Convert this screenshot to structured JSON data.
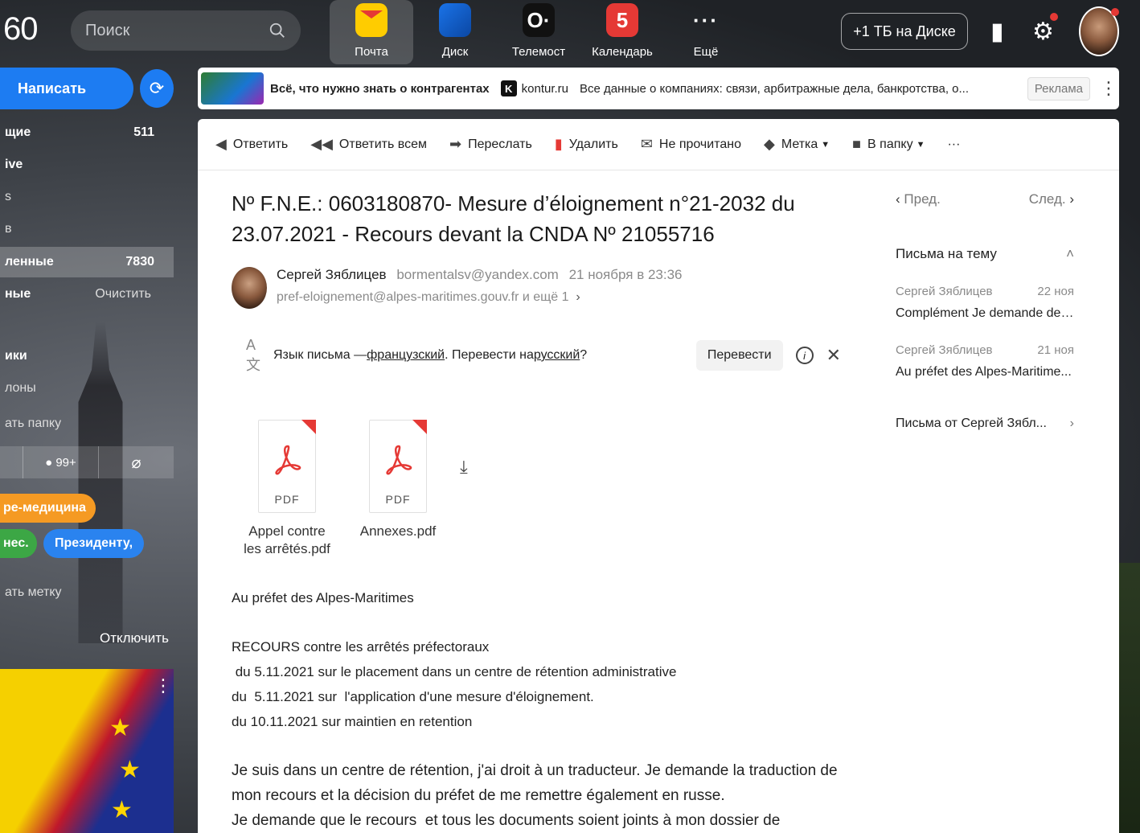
{
  "top": {
    "logo": "60",
    "search_placeholder": "Поиск",
    "apps": [
      {
        "label": "Почта",
        "glyph": ""
      },
      {
        "label": "Диск",
        "glyph": ""
      },
      {
        "label": "Телемост",
        "glyph": "O·"
      },
      {
        "label": "Календарь",
        "glyph": "5"
      },
      {
        "label": "Ещё",
        "glyph": "···"
      }
    ],
    "disk_promo": "+1 ТБ на Диске"
  },
  "sidebar": {
    "compose_label": "Написать",
    "folders": [
      {
        "label": "щие",
        "count": "511"
      },
      {
        "label": "ive",
        "count": ""
      },
      {
        "label": "s",
        "count": ""
      },
      {
        "label": "в",
        "count": ""
      },
      {
        "label": "ленные",
        "count": "7830"
      },
      {
        "label": "ные",
        "action": "Очистить"
      }
    ],
    "extra": [
      "ики",
      "лоны",
      "ать папку"
    ],
    "filter_unread": "99+",
    "tags": [
      "ре-медицина",
      "нес.",
      "Президенту,"
    ],
    "add_tag": "ать метку",
    "disable_label": "Отключить"
  },
  "ad": {
    "headline": "Всё, что нужно знать о контрагентах",
    "domain": "kontur.ru",
    "domain_icon": "K",
    "text": "Все данные о компаниях: связи, арбитражные дела, банкротства, о...",
    "badge": "Реклама"
  },
  "toolbar": {
    "reply": "Ответить",
    "reply_all": "Ответить всем",
    "forward": "Переслать",
    "delete": "Удалить",
    "unread": "Не прочитано",
    "label": "Метка",
    "folder": "В папку",
    "more": "···"
  },
  "message": {
    "subject": "Nº F.N.E.: 0603180870- Mesure d’éloignement n°21-2032 du 23.07.2021 - Recours devant la CNDA Nº 21055716",
    "sender_name": "Сергей Зяблицев",
    "sender_email": "bormentalsv@yandex.com",
    "date": "21 ноября в 23:36",
    "recipients": "pref-eloignement@alpes-maritimes.gouv.fr и ещё 1",
    "translate": {
      "prefix": "Язык письма — ",
      "lang": "французский",
      "mid": ". Перевести на ",
      "target": "русский",
      "suffix": "?",
      "button": "Перевести"
    },
    "attachments": [
      {
        "line1": "Appel contre",
        "line2": "les arrêtés.pdf",
        "type": "PDF"
      },
      {
        "line1": "Annexes.pdf",
        "line2": "",
        "type": "PDF"
      }
    ],
    "body": {
      "p1": "Au préfet des Alpes-Maritimes",
      "p2": "RECOURS  contre les arrêtés préfectoraux",
      "p3": " du 5.11.2021 sur le placement dans un centre de rétention administrative",
      "p4": "du  5.11.2021 sur  l'application d'une mesure d'éloignement.",
      "p5": "du 10.11.2021 sur maintien en retention",
      "p6": "Je suis dans un centre de rétention, j'ai droit à un traducteur. Je demande la traduction de",
      "p7": "mon recours et la décision du préfet de me remettre également en russe.",
      "p8": "Je demande que le recours  et tous les documents soient joints à mon dossier de"
    }
  },
  "right": {
    "prev": "Пред.",
    "next": "След.",
    "thread_title": "Письма на тему",
    "threads": [
      {
        "from": "Сергей Зяблицев",
        "date": "22 ноя",
        "text": "Complément Je demande de j..."
      },
      {
        "from": "Сергей Зяблицев",
        "date": "21 ноя",
        "text": "Au préfet des Alpes-Maritime..."
      }
    ],
    "from_link": "Письма от Сергей Зябл..."
  }
}
